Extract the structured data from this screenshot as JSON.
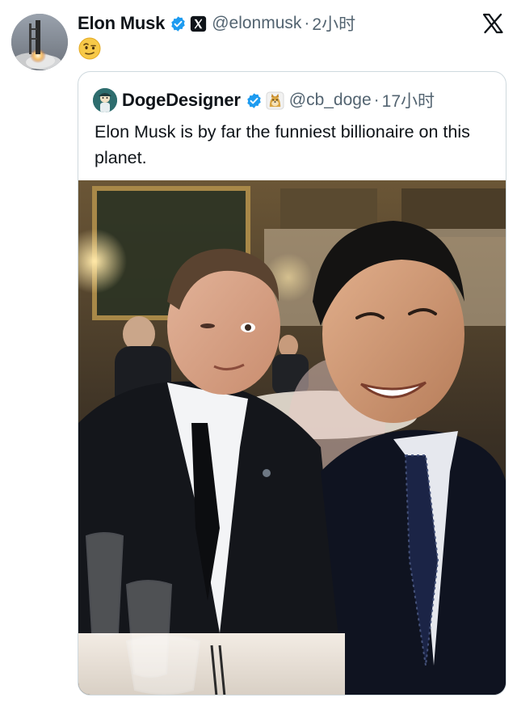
{
  "tweet": {
    "author": {
      "name": "Elon Musk",
      "handle": "@elonmusk"
    },
    "separator": "·",
    "time": "2小时",
    "emoji": "raised-eyebrow-face-emoji"
  },
  "quote": {
    "author": {
      "name": "DogeDesigner",
      "handle": "@cb_doge"
    },
    "separator": "·",
    "time": "17小时",
    "text": "Elon Musk is by far the funniest billionaire on this planet.",
    "photo": "selfie-at-dinner-event"
  },
  "icons": {
    "verified": "verified-badge-icon",
    "org": "x-org-badge-icon",
    "platform": "x-logo-icon",
    "doge": "doge-badge-icon"
  },
  "colors": {
    "verified": "#1d9bf0",
    "secondary_text": "#536471",
    "border": "#cfd9de"
  }
}
